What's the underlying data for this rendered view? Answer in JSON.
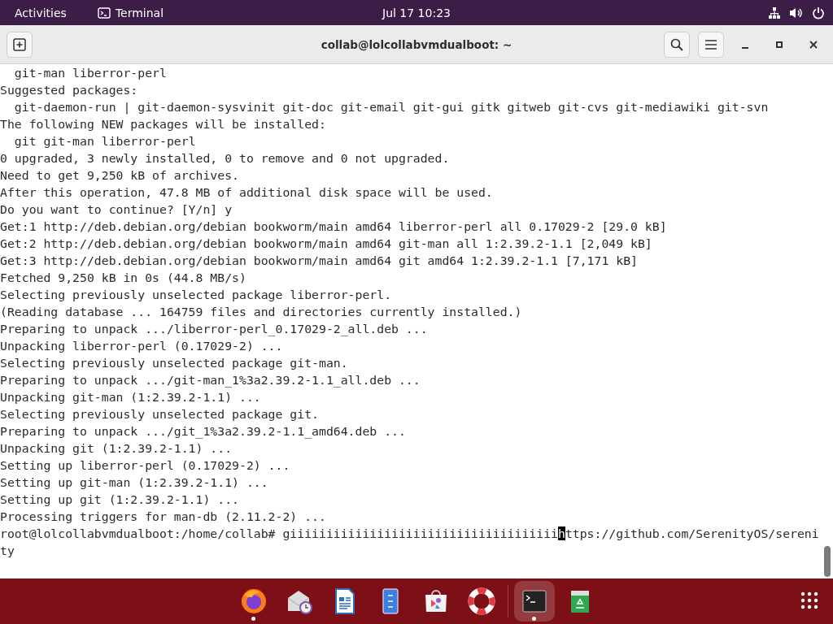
{
  "top_bar": {
    "activities": "Activities",
    "app_name": "Terminal",
    "clock": "Jul 17  10:23"
  },
  "window": {
    "title": "collab@lolcollabvmdualboot: ~"
  },
  "terminal": {
    "lines": [
      "  git-man liberror-perl",
      "Suggested packages:",
      "  git-daemon-run | git-daemon-sysvinit git-doc git-email git-gui gitk gitweb git-cvs git-mediawiki git-svn",
      "The following NEW packages will be installed:",
      "  git git-man liberror-perl",
      "0 upgraded, 3 newly installed, 0 to remove and 0 not upgraded.",
      "Need to get 9,250 kB of archives.",
      "After this operation, 47.8 MB of additional disk space will be used.",
      "Do you want to continue? [Y/n] y",
      "Get:1 http://deb.debian.org/debian bookworm/main amd64 liberror-perl all 0.17029-2 [29.0 kB]",
      "Get:2 http://deb.debian.org/debian bookworm/main amd64 git-man all 1:2.39.2-1.1 [2,049 kB]",
      "Get:3 http://deb.debian.org/debian bookworm/main amd64 git amd64 1:2.39.2-1.1 [7,171 kB]",
      "Fetched 9,250 kB in 0s (44.8 MB/s)",
      "Selecting previously unselected package liberror-perl.",
      "(Reading database ... 164759 files and directories currently installed.)",
      "Preparing to unpack .../liberror-perl_0.17029-2_all.deb ...",
      "Unpacking liberror-perl (0.17029-2) ...",
      "Selecting previously unselected package git-man.",
      "Preparing to unpack .../git-man_1%3a2.39.2-1.1_all.deb ...",
      "Unpacking git-man (1:2.39.2-1.1) ...",
      "Selecting previously unselected package git.",
      "Preparing to unpack .../git_1%3a2.39.2-1.1_amd64.deb ...",
      "Unpacking git (1:2.39.2-1.1) ...",
      "Setting up liberror-perl (0.17029-2) ...",
      "Setting up git-man (1:2.39.2-1.1) ...",
      "Setting up git (1:2.39.2-1.1) ...",
      "Processing triggers for man-db (2.11.2-2) ..."
    ],
    "prompt": "root@lolcollabvmdualboot:/home/collab# ",
    "input_before_cursor": "giiiiiiiiiiiiiiiiiiiiiiiiiiiiiiiiiiiii",
    "cursor_char": "h",
    "input_after_cursor": "ttps://github.com/SerenityOS/serenity"
  },
  "dock": {
    "items": [
      {
        "kind": "browser",
        "running": true,
        "selected": false
      },
      {
        "kind": "mail",
        "running": false,
        "selected": false
      },
      {
        "kind": "document",
        "running": false,
        "selected": false
      },
      {
        "kind": "notes",
        "running": false,
        "selected": false
      },
      {
        "kind": "store",
        "running": false,
        "selected": false
      },
      {
        "kind": "help",
        "running": false,
        "selected": false
      },
      {
        "kind": "terminal",
        "running": true,
        "selected": true
      },
      {
        "kind": "trash",
        "running": false,
        "selected": false
      }
    ]
  }
}
